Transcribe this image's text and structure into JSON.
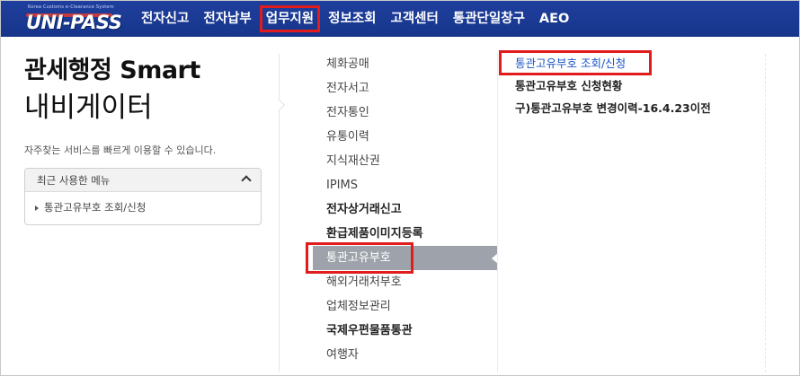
{
  "header": {
    "logo_tagline": "Korea Customs e-Clearance System",
    "logo_word": "UNI-PASS",
    "nav": [
      "전자신고",
      "전자납부",
      "업무지원",
      "정보조회",
      "고객센터",
      "통관단일창구",
      "AEO"
    ],
    "active_nav": "업무지원"
  },
  "left": {
    "title_line1": "관세행정 Smart",
    "title_line2": "내비게이터",
    "description": "자주찾는 서비스를 빠르게 이용할 수 있습니다.",
    "recent_header": "최근 사용한 메뉴",
    "recent_items": [
      "통관고유부호 조회/신청"
    ]
  },
  "middle_menu": [
    {
      "label": "체화공매",
      "bold": false
    },
    {
      "label": "전자서고",
      "bold": false
    },
    {
      "label": "전자통인",
      "bold": false
    },
    {
      "label": "유통이력",
      "bold": false
    },
    {
      "label": "지식재산권",
      "bold": false
    },
    {
      "label": "IPIMS",
      "bold": false
    },
    {
      "label": "전자상거래신고",
      "bold": true
    },
    {
      "label": "환급제품이미지등록",
      "bold": true
    },
    {
      "label": "통관고유부호",
      "bold": false,
      "selected": true
    },
    {
      "label": "해외거래처부호",
      "bold": false
    },
    {
      "label": "업체정보관리",
      "bold": false
    },
    {
      "label": "국제우편물품통관",
      "bold": true
    },
    {
      "label": "여행자",
      "bold": false
    }
  ],
  "right_menu": [
    {
      "label": "통관고유부호 조회/신청",
      "link": true,
      "highlight": true
    },
    {
      "label": "통관고유부호 신청현황",
      "link": false
    },
    {
      "label": "구)통관고유부호 변경이력-16.4.23이전",
      "link": false
    }
  ],
  "colors": {
    "topbar": "#1f3f9e",
    "highlight_box": "#e01c1c",
    "selected_item_bg": "#9ea3ab",
    "link": "#1a55c6"
  }
}
